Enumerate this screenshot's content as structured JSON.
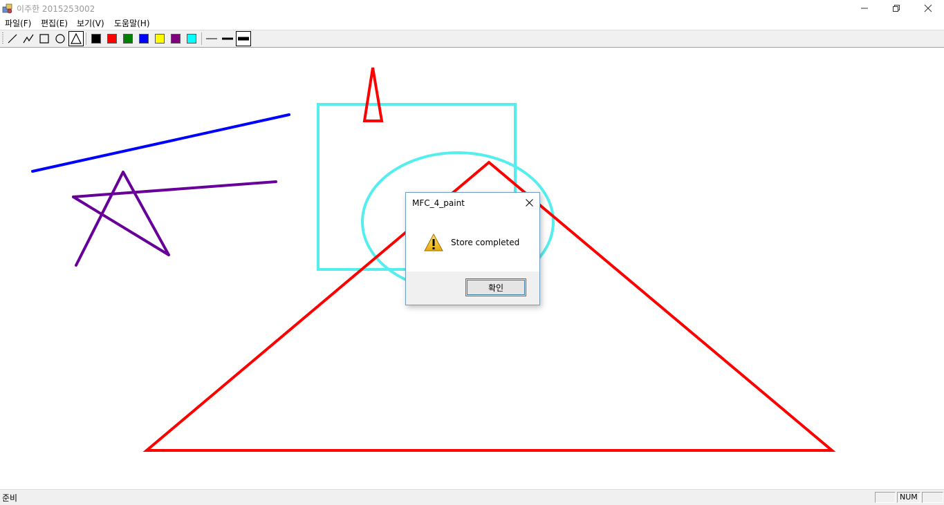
{
  "window": {
    "title": "이주한 2015253002",
    "app_icon": "paint-app-icon",
    "controls": [
      "minimize-icon",
      "restore-icon",
      "close-icon"
    ]
  },
  "menubar": {
    "items": [
      {
        "label": "파일(F)"
      },
      {
        "label": "편집(E)"
      },
      {
        "label": "보기(V)"
      },
      {
        "label": "도움말(H)"
      }
    ]
  },
  "toolbar": {
    "shape_tools": [
      "line-icon",
      "polyline-icon",
      "rectangle-icon",
      "ellipse-icon",
      "triangle-icon"
    ],
    "selected_tool": "triangle-icon",
    "colors": [
      "#000000",
      "#ff0000",
      "#008000",
      "#0000ff",
      "#ffff00",
      "#800080",
      "#00ffff"
    ],
    "line_widths": [
      "thin-line-icon",
      "medium-line-icon",
      "thick-line-icon"
    ],
    "selected_width": "thick-line-icon"
  },
  "drawing": {
    "colors": {
      "blue": "#0000ff",
      "purple": "#660099",
      "cyan": "#55eeee",
      "red": "#ff0000"
    }
  },
  "dialog": {
    "title": "MFC_4_paint",
    "icon": "warning-icon",
    "message": "Store completed",
    "ok_label": "확인"
  },
  "statusbar": {
    "text": "준비",
    "panes": [
      "",
      "NUM",
      ""
    ]
  }
}
